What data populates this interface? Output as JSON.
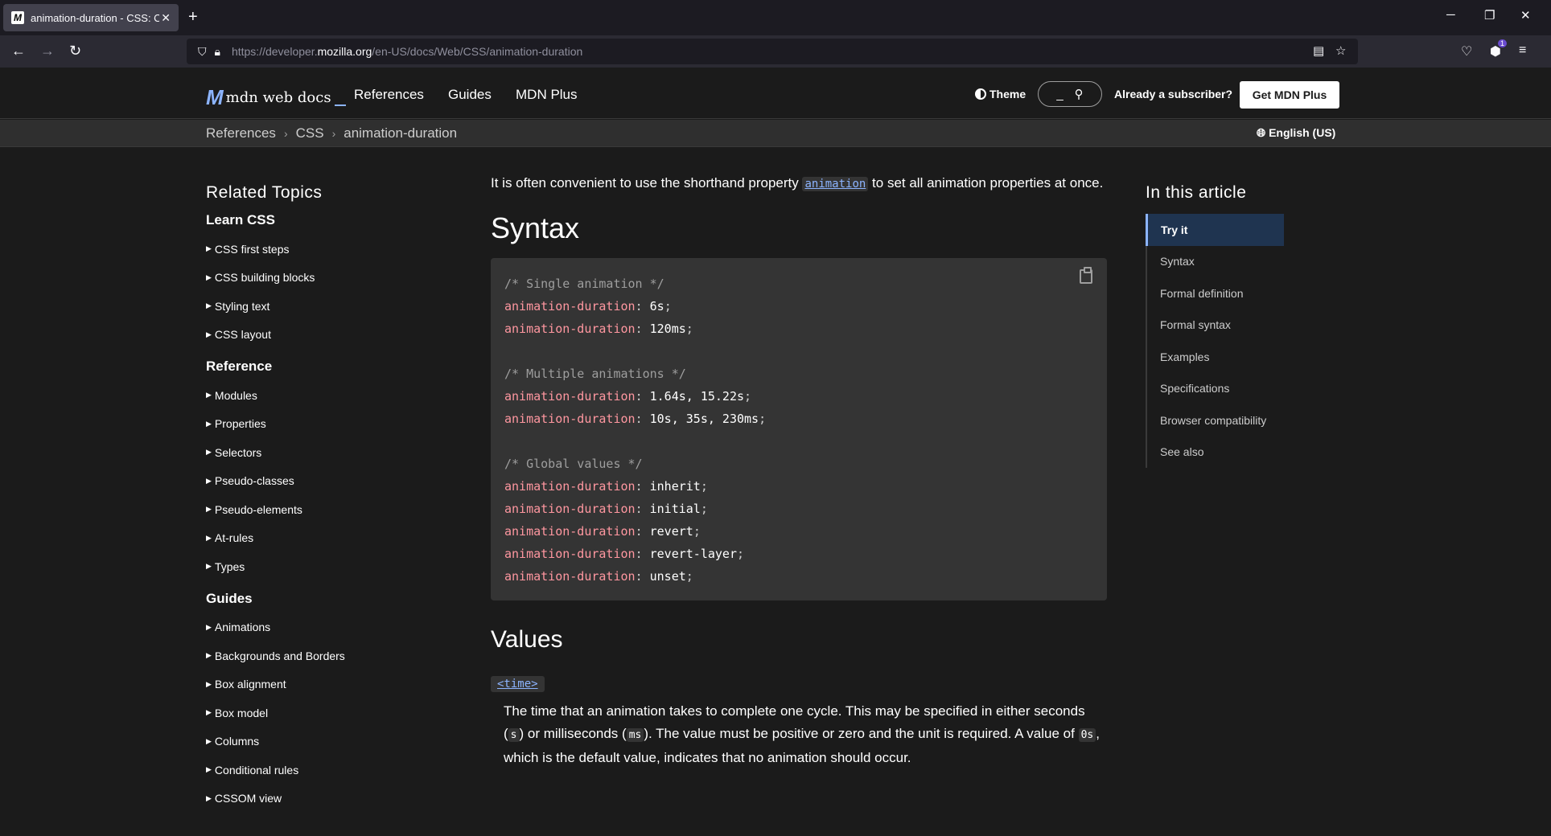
{
  "browser": {
    "tab_title": "animation-duration - CSS: Cascading Style Sheets | MDN",
    "favicon_letter": "M",
    "url_prefix": "https://developer.",
    "url_domain": "mozilla.org",
    "url_path": "/en-US/docs/Web/CSS/animation-duration",
    "badge_count": "1"
  },
  "header": {
    "logo_text": "mdn web docs",
    "nav": [
      "References",
      "Guides",
      "MDN Plus"
    ],
    "theme_label": "Theme",
    "search_placeholder": "_",
    "subscriber_label": "Already a subscriber?",
    "cta_label": "Get MDN Plus"
  },
  "breadcrumbs": [
    "References",
    "CSS",
    "animation-duration"
  ],
  "language": "English (US)",
  "sidebar": {
    "title": "Related Topics",
    "sections": [
      {
        "heading": "Learn CSS",
        "items": [
          "CSS first steps",
          "CSS building blocks",
          "Styling text",
          "CSS layout"
        ]
      },
      {
        "heading": "Reference",
        "items": [
          "Modules",
          "Properties",
          "Selectors",
          "Pseudo-classes",
          "Pseudo-elements",
          "At-rules",
          "Types"
        ]
      },
      {
        "heading": "Guides",
        "items": [
          "Animations",
          "Backgrounds and Borders",
          "Box alignment",
          "Box model",
          "Columns",
          "Conditional rules",
          "CSSOM view"
        ]
      }
    ]
  },
  "content": {
    "lead_before": "It is often convenient to use the shorthand property ",
    "lead_code": "animation",
    "lead_after": " to set all animation properties at once.",
    "syntax_heading": "Syntax",
    "code_lines": [
      {
        "type": "comment",
        "text": "/* Single animation */"
      },
      {
        "type": "decl",
        "prop": "animation-duration",
        "value": "6s"
      },
      {
        "type": "decl",
        "prop": "animation-duration",
        "value": "120ms"
      },
      {
        "type": "blank"
      },
      {
        "type": "comment",
        "text": "/* Multiple animations */"
      },
      {
        "type": "decl",
        "prop": "animation-duration",
        "value": "1.64s, 15.22s"
      },
      {
        "type": "decl",
        "prop": "animation-duration",
        "value": "10s, 35s, 230ms"
      },
      {
        "type": "blank"
      },
      {
        "type": "comment",
        "text": "/* Global values */"
      },
      {
        "type": "decl",
        "prop": "animation-duration",
        "value": "inherit"
      },
      {
        "type": "decl",
        "prop": "animation-duration",
        "value": "initial"
      },
      {
        "type": "decl",
        "prop": "animation-duration",
        "value": "revert"
      },
      {
        "type": "decl",
        "prop": "animation-duration",
        "value": "revert-layer"
      },
      {
        "type": "decl",
        "prop": "animation-duration",
        "value": "unset"
      }
    ],
    "values_heading": "Values",
    "time_chip": "<time>",
    "desc_1": "The time that an animation takes to complete one cycle. This may be specified in either seconds (",
    "desc_code_s": "s",
    "desc_2": ") or milliseconds (",
    "desc_code_ms": "ms",
    "desc_3": "). The value must be positive or zero and the unit is required. A value of ",
    "desc_code_0s": "0s",
    "desc_4": ", which is the default value, indicates that no animation should occur."
  },
  "toc": {
    "title": "In this article",
    "items": [
      "Try it",
      "Syntax",
      "Formal definition",
      "Formal syntax",
      "Examples",
      "Specifications",
      "Browser compatibility",
      "See also"
    ],
    "active_index": 0
  }
}
